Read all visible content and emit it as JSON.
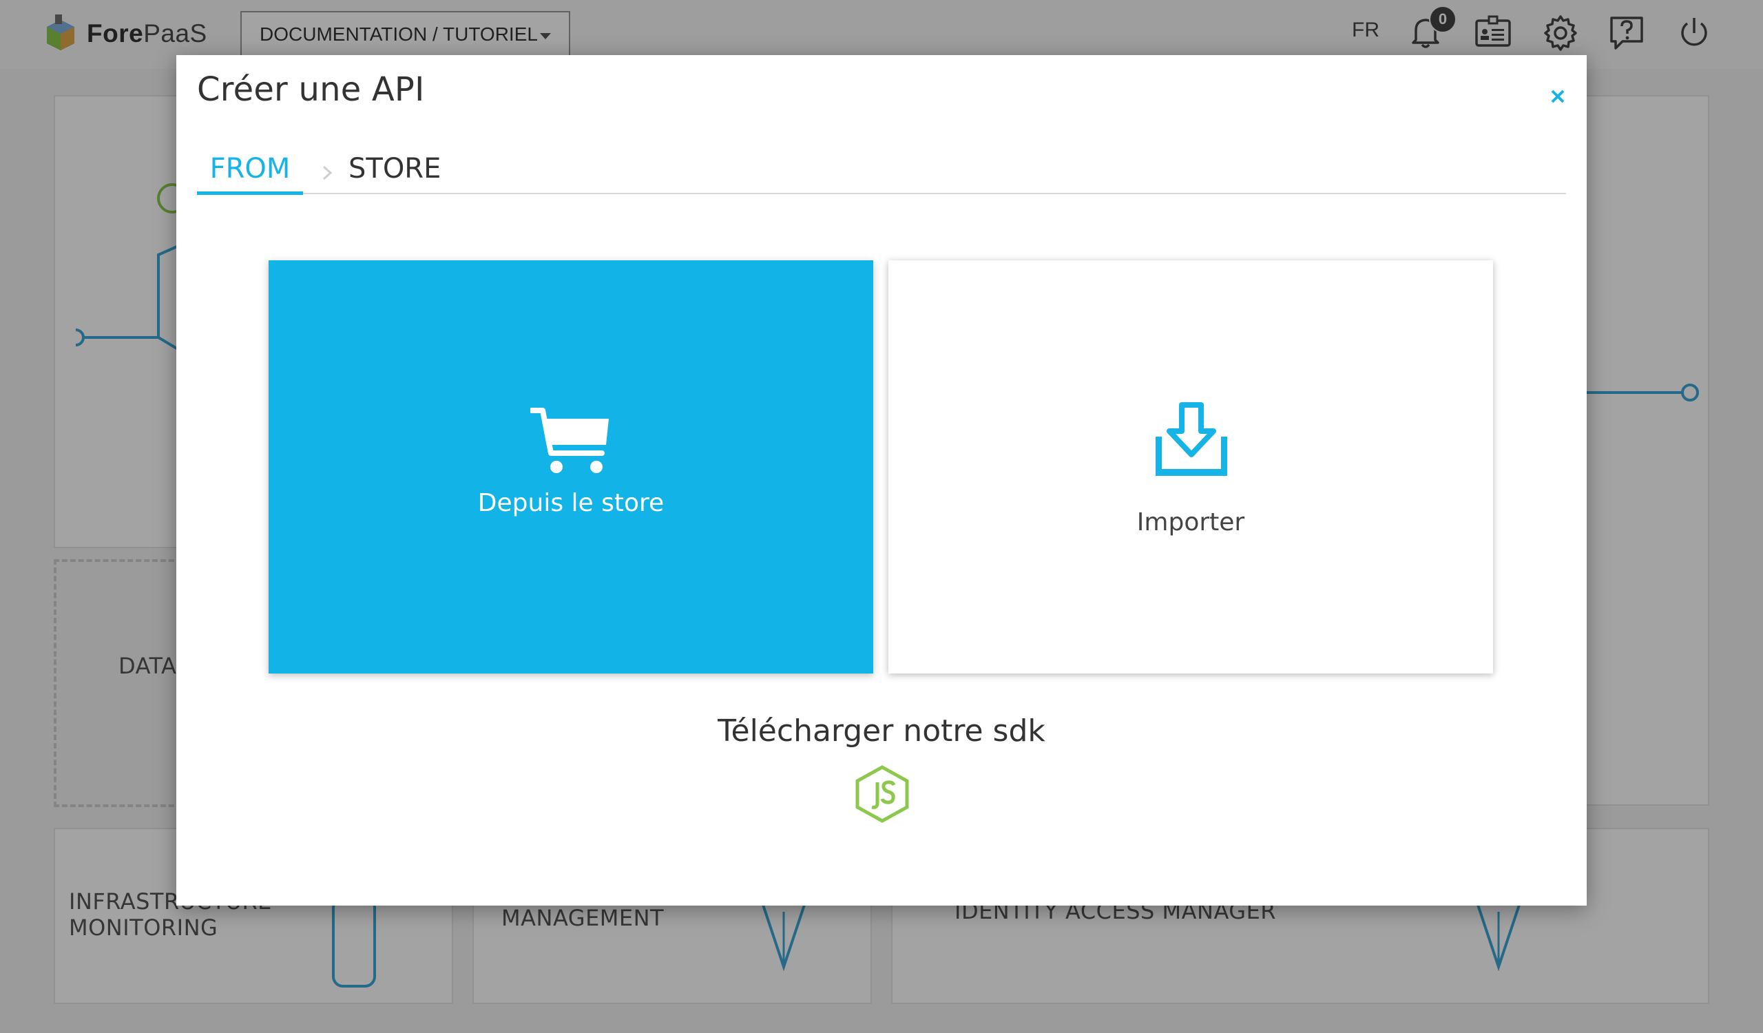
{
  "topbar": {
    "logo_prefix": "Fore",
    "logo_suffix": "PaaS",
    "project": "DOCUMENTATION / TUTORIEL",
    "language": "FR",
    "notification_count": "0",
    "icons": [
      "bell-icon",
      "id-card-icon",
      "gear-icon",
      "help-icon",
      "power-icon"
    ]
  },
  "background": {
    "cards": [
      {
        "label": "DATA"
      },
      {
        "label": "INFRASTRUCTURE MONITORING"
      },
      {
        "label": "MANAGEMENT"
      },
      {
        "label": "IDENTITY ACCESS MANAGER"
      }
    ]
  },
  "modal": {
    "title": "Créer une API",
    "steps": [
      {
        "label": "FROM",
        "active": true
      },
      {
        "label": "STORE",
        "active": false
      }
    ],
    "options": [
      {
        "label": "Depuis le store",
        "icon": "cart-icon",
        "color": "#12b3e6"
      },
      {
        "label": "Importer",
        "icon": "import-icon",
        "color": "#ffffff"
      }
    ],
    "sdk_label": "Télécharger notre sdk",
    "sdk_icon": "nodejs-icon"
  },
  "colors": {
    "accent": "#15b3e6",
    "node_green": "#8cc84b"
  }
}
